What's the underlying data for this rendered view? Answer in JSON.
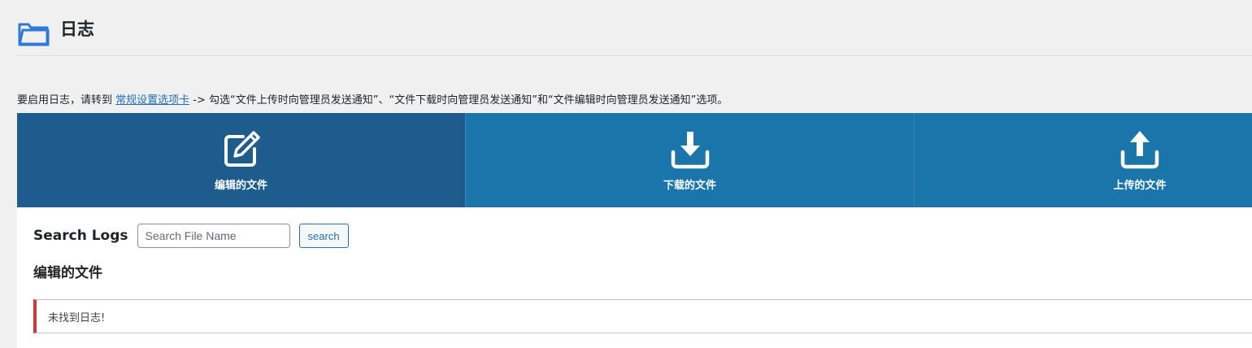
{
  "header": {
    "title": "日志",
    "icon": "folder-icon"
  },
  "notice": {
    "prefix": "要启用日志，请转到 ",
    "link_label": "常规设置选项卡",
    "suffix": " -> 勾选“文件上传时向管理员发送通知”、“文件下载时向管理员发送通知”和“文件编辑时向管理员发送通知”选项。"
  },
  "tabs": [
    {
      "label": "编辑的文件",
      "icon": "edit-icon",
      "active": true
    },
    {
      "label": "下载的文件",
      "icon": "download-icon",
      "active": false
    },
    {
      "label": "上传的文件",
      "icon": "upload-icon",
      "active": false
    }
  ],
  "search": {
    "title": "Search Logs",
    "placeholder": "Search File Name",
    "value": "",
    "button_label": "search"
  },
  "section": {
    "title": "编辑的文件",
    "empty_message": "未找到日志!"
  },
  "colors": {
    "tab_active": "#1e5c8d",
    "tab_inactive": "#1a75aa",
    "link": "#2271b1",
    "error_border": "#d63638"
  }
}
